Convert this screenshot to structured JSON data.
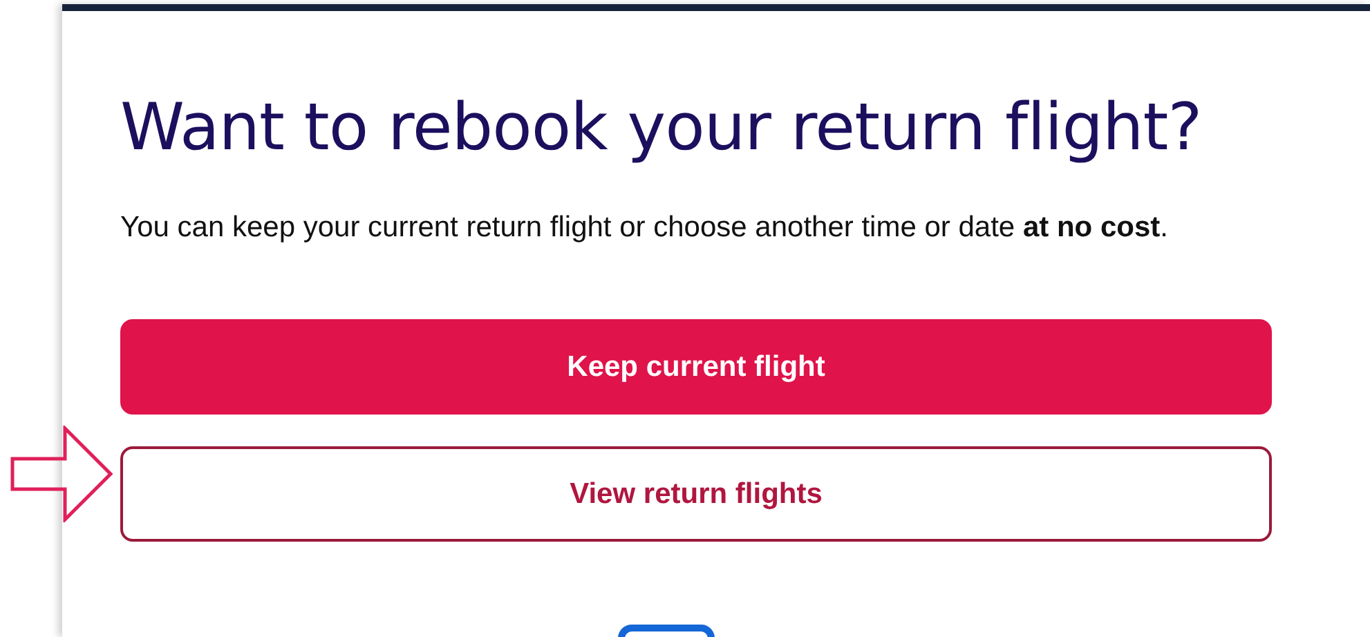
{
  "title": "Want to rebook your return flight?",
  "message": "You can keep your current return flight or choose another time or date **at no cost**.",
  "buttons": [
    {
      "label": "Keep current flight",
      "kind": "primary"
    },
    {
      "label": "View return flights",
      "kind": "secondary"
    }
  ]
}
